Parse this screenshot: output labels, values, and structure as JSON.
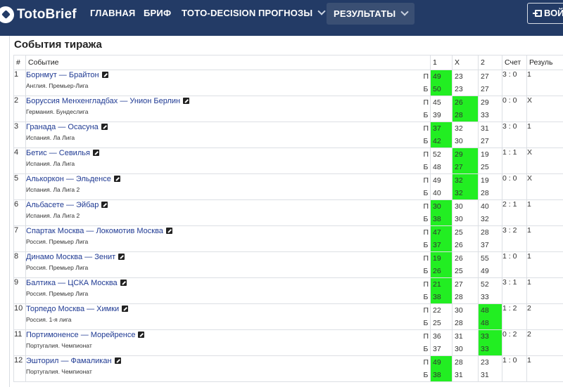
{
  "nav": {
    "logo": "TotoBrief",
    "items": [
      "ГЛАВНАЯ",
      "БРИФ",
      "TOTO-DECISION",
      "ПРОГНОЗЫ",
      "РЕЗУЛЬТАТЫ"
    ],
    "login": "ВОЙ"
  },
  "page_title": "События тиража",
  "table": {
    "headers": [
      "#",
      "Событие",
      "1",
      "X",
      "2",
      "Счет",
      "Резуль"
    ],
    "pb": [
      "П",
      "Б"
    ],
    "rows": [
      {
        "n": "1",
        "event": "Борнмут — Брайтон",
        "league": "Англия. Премьер-Лига",
        "p": [
          "49",
          "23",
          "27"
        ],
        "b": [
          "50",
          "23",
          "27"
        ],
        "hl": 0,
        "score": "3 : 0",
        "result": "1"
      },
      {
        "n": "2",
        "event": "Боруссия Менхенгладбах — Унион Берлин",
        "league": "Германия. Бундеслига",
        "p": [
          "45",
          "26",
          "29"
        ],
        "b": [
          "39",
          "28",
          "33"
        ],
        "hl": 1,
        "score": "0 : 0",
        "result": "X"
      },
      {
        "n": "3",
        "event": "Гранада — Осасуна",
        "league": "Испания. Ла Лига",
        "p": [
          "37",
          "32",
          "31"
        ],
        "b": [
          "42",
          "30",
          "27"
        ],
        "hl": 0,
        "score": "3 : 0",
        "result": "1"
      },
      {
        "n": "4",
        "event": "Бетис — Севилья",
        "league": "Испания. Ла Лига",
        "p": [
          "52",
          "29",
          "19"
        ],
        "b": [
          "48",
          "27",
          "25"
        ],
        "hl": 1,
        "score": "1 : 1",
        "result": "X"
      },
      {
        "n": "5",
        "event": "Алькоркон — Эльденсе",
        "league": "Испания. Ла Лига 2",
        "p": [
          "49",
          "32",
          "19"
        ],
        "b": [
          "40",
          "32",
          "28"
        ],
        "hl": 1,
        "score": "0 : 0",
        "result": "X"
      },
      {
        "n": "6",
        "event": "Альбасете — Эйбар",
        "league": "Испания. Ла Лига 2",
        "p": [
          "30",
          "30",
          "40"
        ],
        "b": [
          "38",
          "30",
          "32"
        ],
        "hl": 0,
        "score": "2 : 1",
        "result": "1"
      },
      {
        "n": "7",
        "event": "Спартак Москва — Локомотив Москва",
        "league": "Россия. Премьер Лига",
        "p": [
          "47",
          "25",
          "28"
        ],
        "b": [
          "37",
          "26",
          "37"
        ],
        "hl": 0,
        "score": "3 : 2",
        "result": "1"
      },
      {
        "n": "8",
        "event": "Динамо Москва — Зенит",
        "league": "Россия. Премьер Лига",
        "p": [
          "19",
          "26",
          "55"
        ],
        "b": [
          "26",
          "25",
          "49"
        ],
        "hl": 0,
        "score": "1 : 0",
        "result": "1"
      },
      {
        "n": "9",
        "event": "Балтика — ЦСКА Москва",
        "league": "Россия. Премьер Лига",
        "p": [
          "21",
          "27",
          "52"
        ],
        "b": [
          "38",
          "28",
          "33"
        ],
        "hl": 0,
        "score": "3 : 1",
        "result": "1"
      },
      {
        "n": "10",
        "event": "Торпедо Москва — Химки",
        "league": "Россия. 1-я лига",
        "p": [
          "22",
          "30",
          "48"
        ],
        "b": [
          "25",
          "28",
          "48"
        ],
        "hl": 2,
        "score": "1 : 2",
        "result": "2"
      },
      {
        "n": "11",
        "event": "Портимоненсе — Морейренсе",
        "league": "Португалия. Чемпионат",
        "p": [
          "36",
          "31",
          "33"
        ],
        "b": [
          "37",
          "30",
          "33"
        ],
        "hl": 2,
        "score": "0 : 2",
        "result": "2"
      },
      {
        "n": "12",
        "event": "Эшторил — Фамаликан",
        "league": "Португалия. Чемпионат",
        "p": [
          "49",
          "28",
          "23"
        ],
        "b": [
          "38",
          "31",
          "31"
        ],
        "hl": 0,
        "score": "1 : 0",
        "result": "1"
      }
    ]
  },
  "colors": {
    "navbar": "#233b66",
    "highlight": "#22ee22",
    "link": "#1f3a93"
  }
}
